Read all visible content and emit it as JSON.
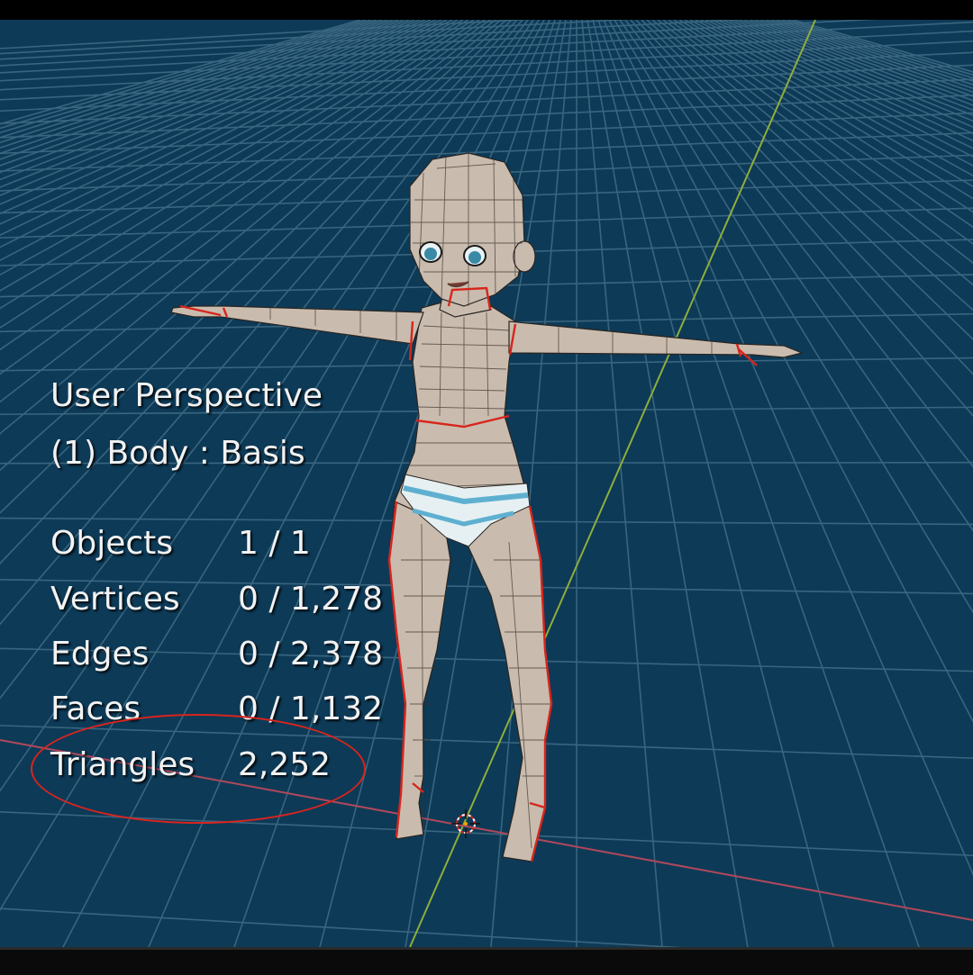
{
  "viewport": {
    "view_name": "User Perspective",
    "object_info": "(1) Body : Basis"
  },
  "stats": [
    {
      "label": "Objects",
      "value": "1 / 1"
    },
    {
      "label": "Vertices",
      "value": "0 / 1,278"
    },
    {
      "label": "Edges",
      "value": "0 / 2,378"
    },
    {
      "label": "Faces",
      "value": "0 / 1,132"
    },
    {
      "label": "Triangles",
      "value": "2,252"
    }
  ],
  "colors": {
    "viewport_background": "#0d3a57",
    "grid_line": "#3e6a84",
    "x_axis": "#b0485a",
    "y_axis": "#8fae3a",
    "mesh_skin": "#c9bcae",
    "seam": "#d8251c",
    "highlight": "#d9241e"
  },
  "icons": {
    "cursor": "3d-cursor-icon",
    "model": "character-mesh"
  }
}
